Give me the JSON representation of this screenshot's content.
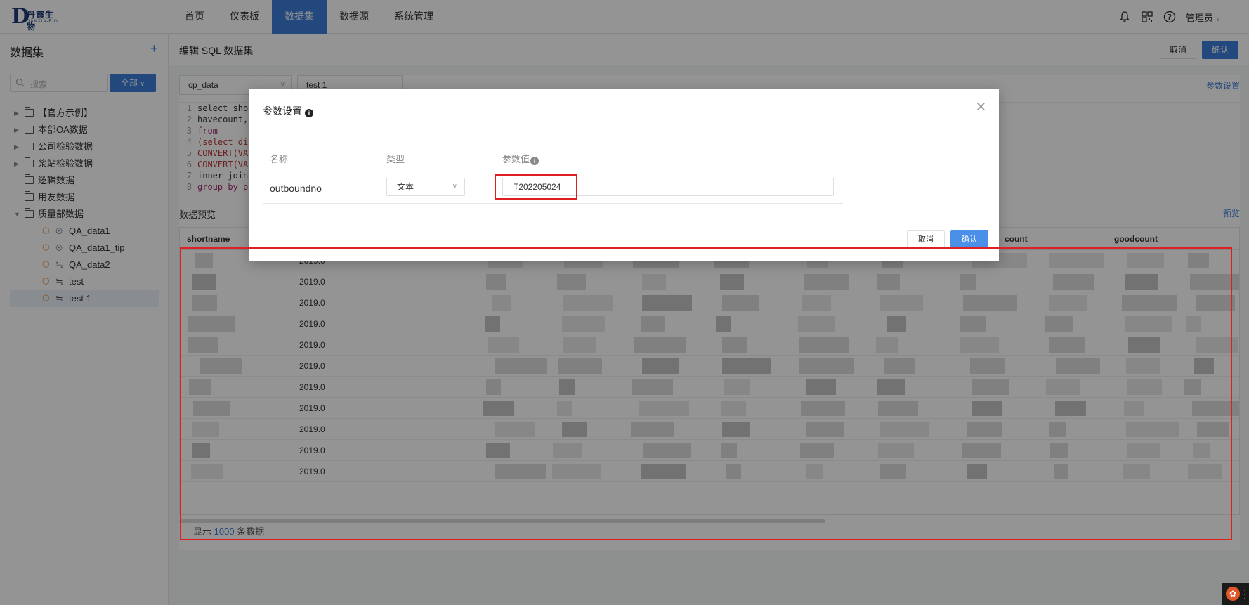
{
  "brand": {
    "logo_letter": "D",
    "logo_cn": "丹霞生物",
    "logo_en": "DANXIA-BIO"
  },
  "nav": {
    "items": [
      "首页",
      "仪表板",
      "数据集",
      "数据源",
      "系统管理"
    ],
    "active_index": 2
  },
  "header_right": {
    "user": "管理员",
    "icons": [
      "bell-icon",
      "qr-icon",
      "help-icon"
    ]
  },
  "sidebar": {
    "title": "数据集",
    "add_label": "+",
    "search_placeholder": "搜索",
    "filter_label": "全部",
    "tree": [
      {
        "label": "【官方示例】",
        "type": "folder",
        "expandable": true
      },
      {
        "label": "本部OA数据",
        "type": "folder",
        "expandable": true
      },
      {
        "label": "公司检验数据",
        "type": "folder",
        "expandable": true
      },
      {
        "label": "浆站检验数据",
        "type": "folder",
        "expandable": true
      },
      {
        "label": "逻辑数据",
        "type": "folder",
        "expandable": false
      },
      {
        "label": "用友数据",
        "type": "folder",
        "expandable": false
      },
      {
        "label": "质量部数据",
        "type": "folder",
        "expandable": true,
        "expanded": true
      },
      {
        "label": "QA_data1",
        "type": "dataset",
        "kind": "timer"
      },
      {
        "label": "QA_data1_tip",
        "type": "dataset",
        "kind": "timer"
      },
      {
        "label": "QA_data2",
        "type": "dataset",
        "kind": "sql"
      },
      {
        "label": "test",
        "type": "dataset",
        "kind": "sql"
      },
      {
        "label": "test 1",
        "type": "dataset",
        "kind": "sql",
        "selected": true
      }
    ]
  },
  "main": {
    "title": "编辑 SQL 数据集",
    "cancel_label": "取消",
    "confirm_label": "确认",
    "datasource_select": "cp_data",
    "dataset_name": "test 1",
    "param_link": "参数设置",
    "code_lines": [
      {
        "n": "1",
        "text": "select shor"
      },
      {
        "n": "2",
        "text": "havecount,g"
      },
      {
        "n": "3",
        "text": " from"
      },
      {
        "n": "4",
        "text": " (select di"
      },
      {
        "n": "5",
        "text": "CONVERT(VAF"
      },
      {
        "n": "6",
        "text": "CONVERT(VAF"
      },
      {
        "n": "7",
        "text": "inner join"
      },
      {
        "n": "8",
        "text": "group by ps"
      }
    ],
    "preview_title": "数据预览",
    "preview_link": "预览",
    "columns": [
      "shortname",
      "count",
      "goodcount"
    ],
    "row_date_prefix": "2019.0",
    "row_count": 11,
    "footer_prefix": "显示",
    "footer_count": "1000",
    "footer_suffix": "条数据"
  },
  "modal": {
    "title": "参数设置",
    "col_name": "名称",
    "col_type": "类型",
    "col_value": "参数值",
    "param_name": "outboundno",
    "param_type": "文本",
    "param_value": "T202205024",
    "cancel_label": "取消",
    "confirm_label": "确认"
  },
  "colors": {
    "primary": "#3b7dd8",
    "annotation": "#e02020",
    "dataset_icon": "#e6893a"
  }
}
